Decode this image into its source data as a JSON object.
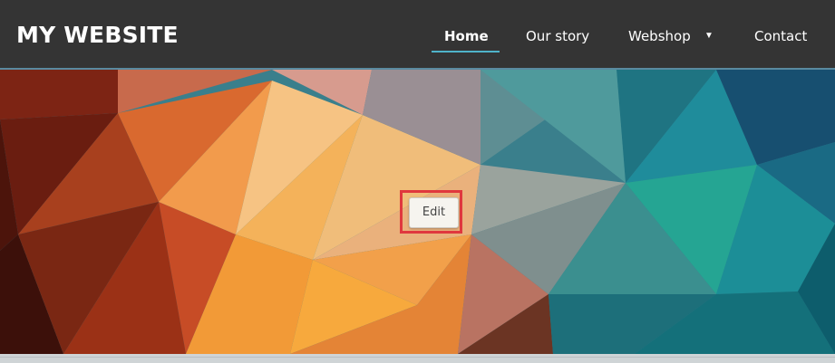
{
  "site": {
    "brand": "MY WEBSITE"
  },
  "nav": {
    "items": [
      {
        "label": "Home",
        "active": true
      },
      {
        "label": "Our story",
        "active": false
      },
      {
        "label": "Webshop",
        "active": false,
        "has_dropdown": true
      },
      {
        "label": "Contact",
        "active": false
      }
    ],
    "dropdown_caret": "▼",
    "underline_color": "#4fb3c9"
  },
  "hero": {
    "edit_label": "Edit",
    "highlight_color": "#e0383e"
  },
  "colors": {
    "navbar": "#343434",
    "navbar_text": "#ffffff"
  }
}
